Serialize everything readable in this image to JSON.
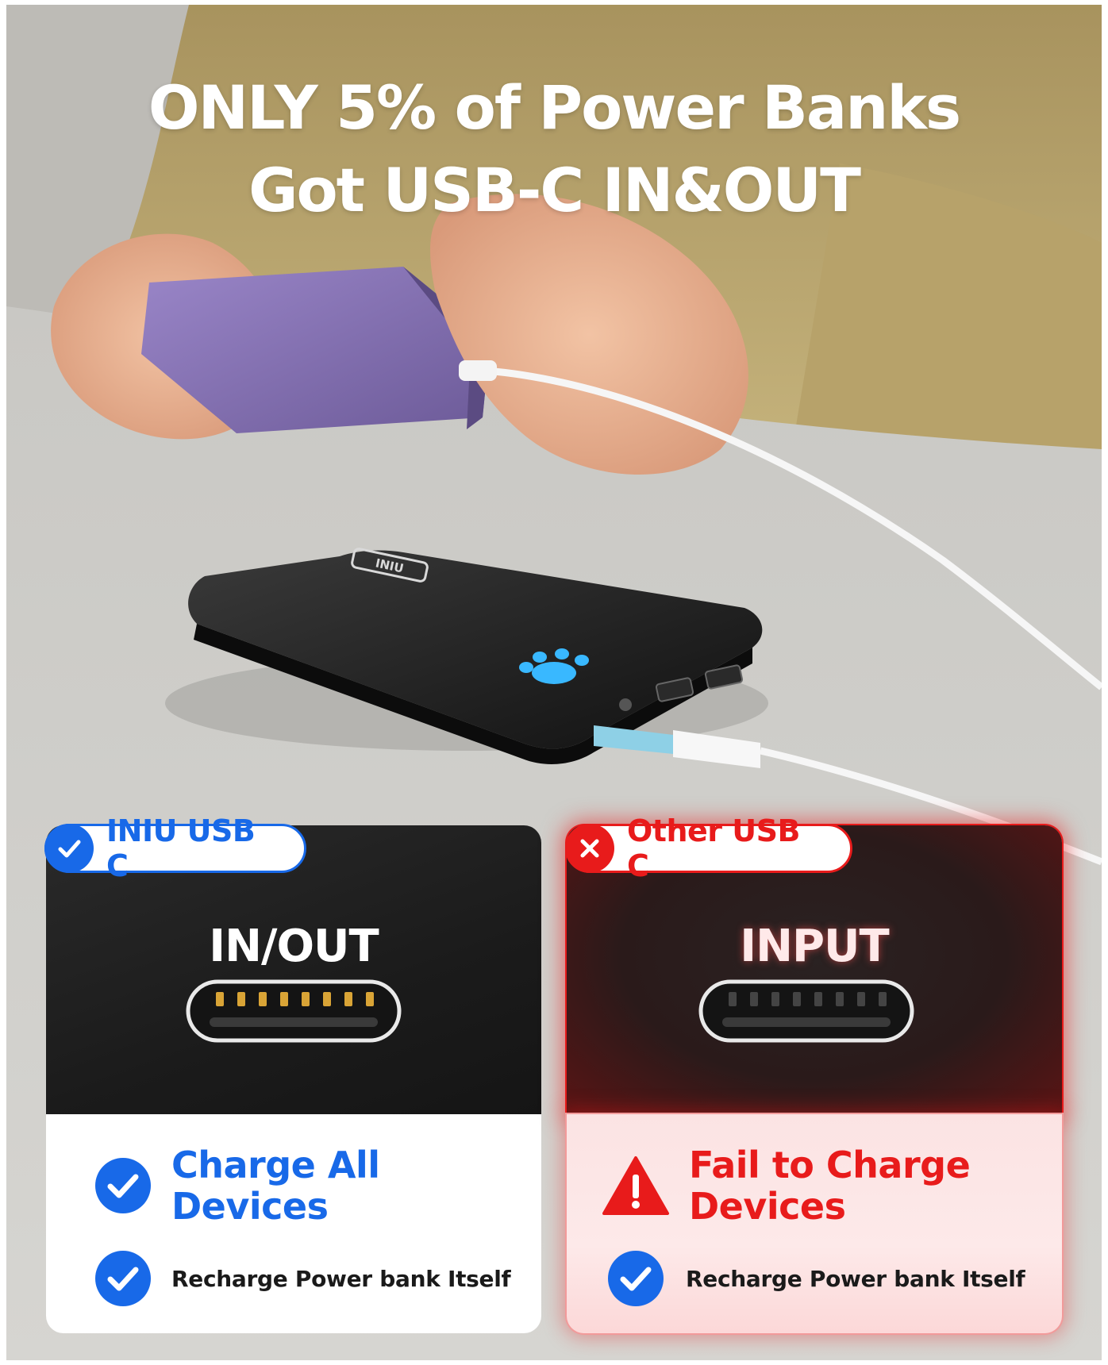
{
  "headline": {
    "line1": "ONLY 5% of Power Banks",
    "line2": "Got USB-C IN&OUT"
  },
  "product": {
    "brand_label": "INIU"
  },
  "left_panel": {
    "badge": "INIU USB C",
    "badge_icon": "check-icon",
    "port_label": "IN/OUT",
    "feature_main": "Charge All Devices",
    "feature_secondary": "Recharge Power bank Itself",
    "accent_color": "#1869e8"
  },
  "right_panel": {
    "badge": "Other USB C",
    "badge_icon": "cross-icon",
    "port_label": "INPUT",
    "feature_main": "Fail to Charge Devices",
    "feature_secondary": "Recharge Power bank Itself",
    "accent_color": "#e81b1b"
  }
}
